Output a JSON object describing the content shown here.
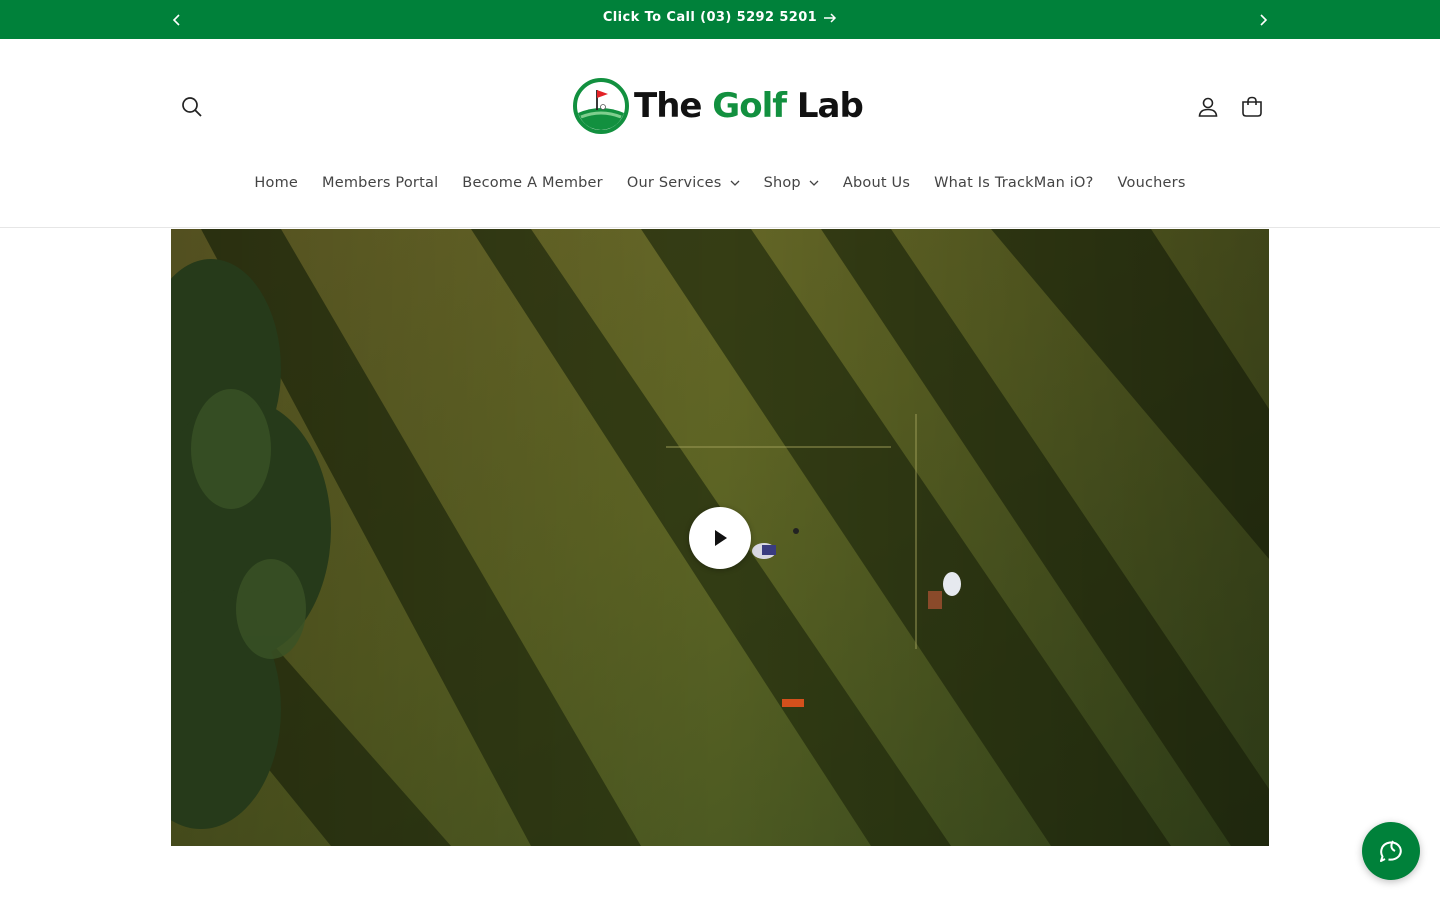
{
  "announcement": {
    "text": "Click To Call (03) 5292 5201",
    "background": "#00813a"
  },
  "header": {
    "logo": {
      "word1": "The ",
      "word2": "Golf",
      "word3": " Lab"
    },
    "icons": [
      "search-icon",
      "account-icon",
      "cart-icon"
    ]
  },
  "nav": {
    "items": [
      {
        "label": "Home"
      },
      {
        "label": "Members Portal"
      },
      {
        "label": "Become A Member"
      },
      {
        "label": "Our Services"
      },
      {
        "label": "Shop"
      },
      {
        "label": "About Us"
      },
      {
        "label": "What Is TrackMan iO?"
      },
      {
        "label": "Vouchers"
      }
    ]
  },
  "hero": {
    "type": "video",
    "play_icon": "play-icon"
  },
  "chat": {
    "icon": "chat-icon",
    "color": "#00813a"
  }
}
